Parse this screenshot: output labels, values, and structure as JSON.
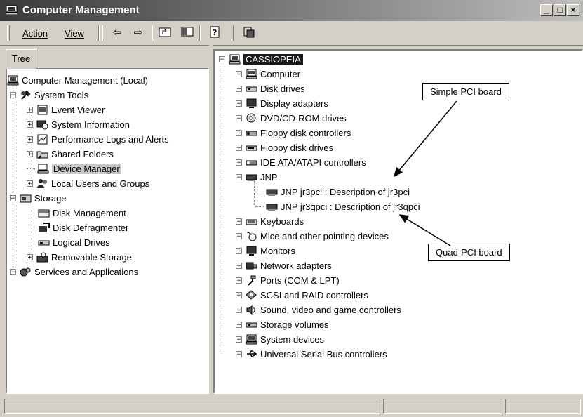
{
  "window": {
    "title": "Computer Management",
    "min": "_",
    "max": "□",
    "close": "×"
  },
  "menu": {
    "action": "Action",
    "view": "View"
  },
  "left": {
    "tab": "Tree",
    "root": "Computer Management (Local)",
    "system_tools": "System Tools",
    "items": [
      "Event Viewer",
      "System Information",
      "Performance Logs and Alerts",
      "Shared Folders",
      "Device Manager",
      "Local Users and Groups"
    ],
    "storage": "Storage",
    "storage_items": [
      "Disk Management",
      "Disk Defragmenter",
      "Logical Drives",
      "Removable Storage"
    ],
    "services": "Services and Applications"
  },
  "right": {
    "root": "CASSIOPEIA",
    "devices_top": [
      "Computer",
      "Disk drives",
      "Display adapters",
      "DVD/CD-ROM drives",
      "Floppy disk controllers",
      "Floppy disk drives",
      "IDE ATA/ATAPI controllers"
    ],
    "jnp": "JNP",
    "jnp_children": [
      "JNP jr3pci : Description of jr3pci",
      "JNP jr3qpci : Description of jr3qpci"
    ],
    "devices_bottom": [
      "Keyboards",
      "Mice and other pointing devices",
      "Monitors",
      "Network adapters",
      "Ports (COM & LPT)",
      "SCSI and RAID controllers",
      "Sound, video and game controllers",
      "Storage volumes",
      "System devices",
      "Universal Serial Bus controllers"
    ]
  },
  "callouts": {
    "simple": "Simple PCI board",
    "quad": "Quad-PCI board"
  }
}
